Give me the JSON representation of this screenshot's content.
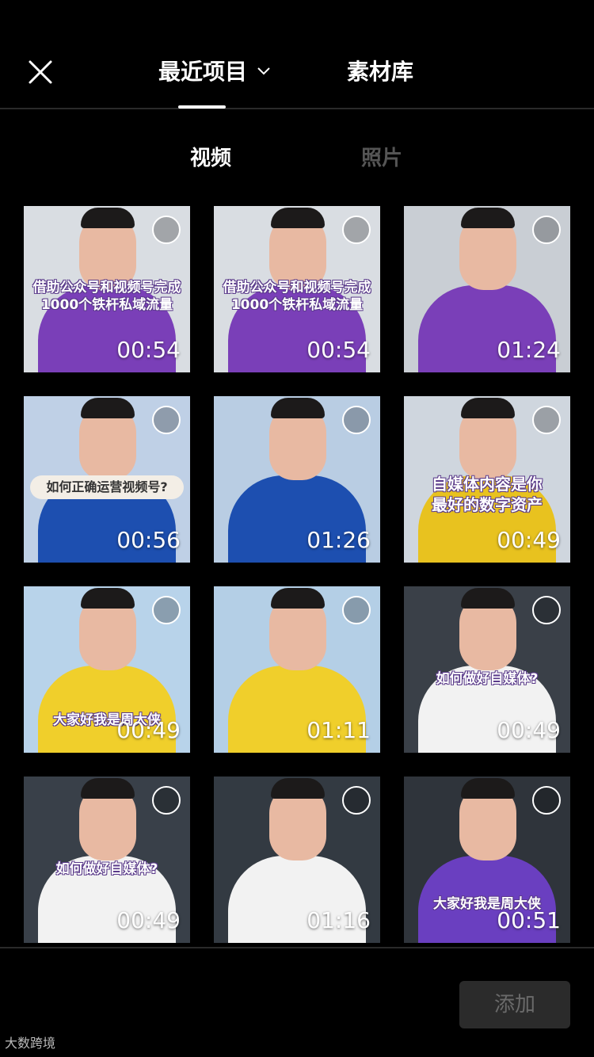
{
  "header": {
    "tabs": [
      {
        "label": "最近项目",
        "active": true
      },
      {
        "label": "素材库",
        "active": false
      }
    ],
    "close_icon": "close-icon",
    "dropdown_icon": "chevron-down-icon"
  },
  "subtabs": [
    {
      "label": "视频",
      "active": true
    },
    {
      "label": "照片",
      "active": false
    }
  ],
  "videos": [
    {
      "duration": "00:54",
      "caption": "借助公众号和视频号完成\n1000个铁杆私域流量",
      "shirt": "#7a3fb8",
      "bg": "#d9dde2"
    },
    {
      "duration": "00:54",
      "caption": "借助公众号和视频号完成\n1000个铁杆私域流量",
      "shirt": "#7a3fb8",
      "bg": "#d9dde2"
    },
    {
      "duration": "01:24",
      "caption": "",
      "shirt": "#7a3fb8",
      "bg": "#c9ced4"
    },
    {
      "duration": "00:56",
      "caption": "如何正确运营视频号?",
      "shirt": "#1d4fb0",
      "bg": "#bfd0e6"
    },
    {
      "duration": "01:26",
      "caption": "",
      "shirt": "#1d4fb0",
      "bg": "#b9cde3"
    },
    {
      "duration": "00:49",
      "caption": "自媒体内容是你\n最好的数字资产",
      "shirt": "#e8c21f",
      "bg": "#cfd6de"
    },
    {
      "duration": "00:49",
      "caption": "大家好我是周大侠",
      "shirt": "#f0cf2b",
      "bg": "#b8d3ea"
    },
    {
      "duration": "01:11",
      "caption": "",
      "shirt": "#f0cf2b",
      "bg": "#b4cfe6"
    },
    {
      "duration": "00:49",
      "caption": "如何做好自媒体?",
      "shirt": "#f2f2f2",
      "bg": "#3a4048"
    },
    {
      "duration": "00:49",
      "caption": "如何做好自媒体?",
      "shirt": "#f2f2f2",
      "bg": "#394049"
    },
    {
      "duration": "01:16",
      "caption": "",
      "shirt": "#f2f2f2",
      "bg": "#333a42"
    },
    {
      "duration": "00:51",
      "caption": "大家好我是周大侠",
      "shirt": "#6a3fc0",
      "bg": "#2f343b"
    }
  ],
  "footer": {
    "add_label": "添加",
    "watermark": "大数跨境"
  }
}
